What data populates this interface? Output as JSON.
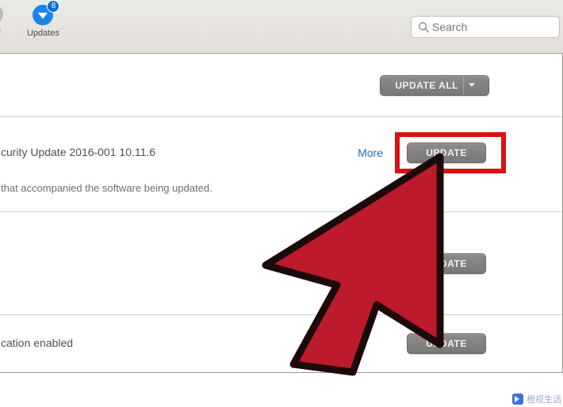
{
  "toolbar": {
    "purchased_label": "sed",
    "updates_label": "Updates",
    "updates_badge_count": "8",
    "search_placeholder": "Search"
  },
  "actions": {
    "update_all_label": "UPDATE ALL",
    "update_label": "UPDATE"
  },
  "items": [
    {
      "title": "curity Update 2016-001 10.11.6",
      "more_label": "More",
      "description": "that accompanied the software being updated."
    },
    {
      "title": "cation enabled"
    }
  ],
  "watermark": {
    "text": "橙视生活"
  }
}
